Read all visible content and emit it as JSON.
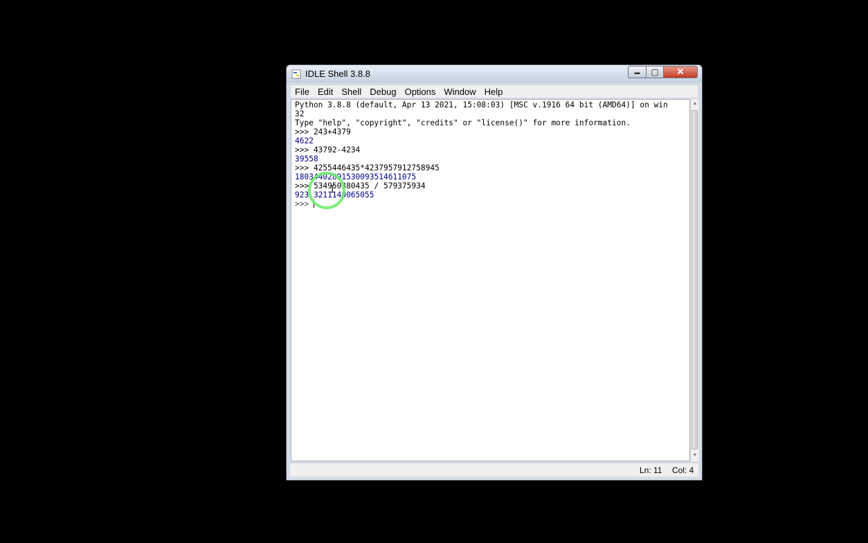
{
  "window": {
    "title": "IDLE Shell 3.8.8",
    "icon": "python-idle-icon",
    "controls": {
      "minimize": "▬",
      "maximize": "▢",
      "close": "✕"
    }
  },
  "menu": {
    "items": [
      "File",
      "Edit",
      "Shell",
      "Debug",
      "Options",
      "Window",
      "Help"
    ]
  },
  "shell": {
    "lines": [
      {
        "text": "Python 3.8.8 (default, Apr 13 2021, 15:08:03) [MSC v.1916 64 bit (AMD64)] on win",
        "kind": "banner"
      },
      {
        "text": "32",
        "kind": "banner"
      },
      {
        "text": "Type \"help\", \"copyright\", \"credits\" or \"license()\" for more information.",
        "kind": "banner"
      },
      {
        "text": ">>> 243+4379",
        "kind": "input"
      },
      {
        "text": "4622",
        "kind": "output"
      },
      {
        "text": ">>> 43792-4234",
        "kind": "input"
      },
      {
        "text": "39558",
        "kind": "output"
      },
      {
        "text": ">>> 4255446435*4237957912758945",
        "kind": "input"
      },
      {
        "text": "18034402891530093514611075",
        "kind": "output"
      },
      {
        "text": ">>> 534950380435 / 579375934",
        "kind": "input"
      },
      {
        "text": "923.3211140065055",
        "kind": "output"
      },
      {
        "text": ">>> ",
        "kind": "prompt"
      }
    ]
  },
  "status": {
    "line": "Ln: 11",
    "column": "Col: 4"
  },
  "colors": {
    "output": "#00008b",
    "cursor_highlight": "#70ec70"
  }
}
